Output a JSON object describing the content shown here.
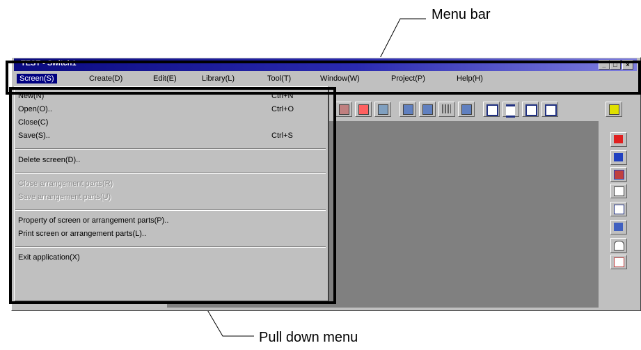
{
  "window": {
    "title": "TEST - Switch1",
    "controls": [
      "_",
      "□",
      "×"
    ]
  },
  "menubar": {
    "items": [
      {
        "label": "Screen(S)",
        "active": true
      },
      {
        "label": "Create(D)"
      },
      {
        "label": "Edit(E)"
      },
      {
        "label": "Library(L)"
      },
      {
        "label": "Tool(T)"
      },
      {
        "label": "Window(W)"
      },
      {
        "label": "Project(P)"
      },
      {
        "label": "Help(H)"
      }
    ]
  },
  "dropdown": {
    "new": "New(N)",
    "new_shortcut": "Ctrl+N",
    "open": "Open(O)..",
    "open_shortcut": "Ctrl+O",
    "close": "Close(C)",
    "save": "Save(S)..",
    "save_shortcut": "Ctrl+S",
    "delete": "Delete screen(D)..",
    "close_parts": "Close arrangement parts(R)",
    "save_parts": "Save arrangement parts(U)",
    "property": "Property of screen or arrangement parts(P)..",
    "print": "Print screen or arrangement parts(L)..",
    "exit": "Exit application(X)"
  },
  "annotations": {
    "menu_bar": "Menu bar",
    "pull_down_menu": "Pull down menu"
  },
  "colors": {
    "titlebar": "#0a0a80",
    "face": "#c0c0c0",
    "client": "#808080",
    "highlight": "#000080"
  }
}
